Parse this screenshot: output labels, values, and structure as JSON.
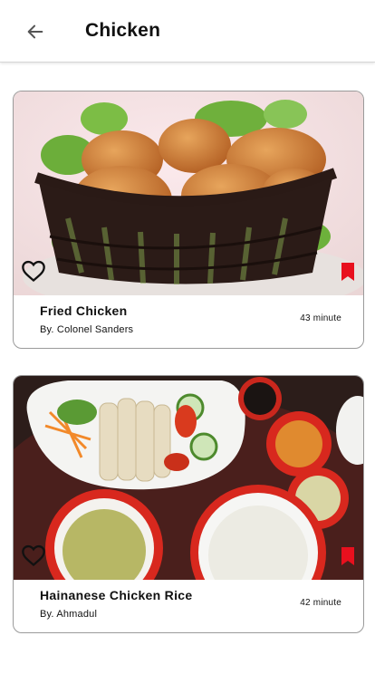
{
  "appbar": {
    "title": "Chicken",
    "back_icon": "arrow-left-icon"
  },
  "recipes": [
    {
      "name": "Fried Chicken",
      "author": "By. Colonel Sanders",
      "time": "43 minute",
      "favorite_icon": "heart-outline-icon",
      "bookmark_icon": "bookmark-icon"
    },
    {
      "name": "Hainanese Chicken Rice",
      "author": "By. Ahmadul",
      "time": "42 minute",
      "favorite_icon": "heart-outline-icon",
      "bookmark_icon": "bookmark-icon"
    }
  ],
  "colors": {
    "bookmark": "#e8101e",
    "border": "#9a9a9a"
  }
}
